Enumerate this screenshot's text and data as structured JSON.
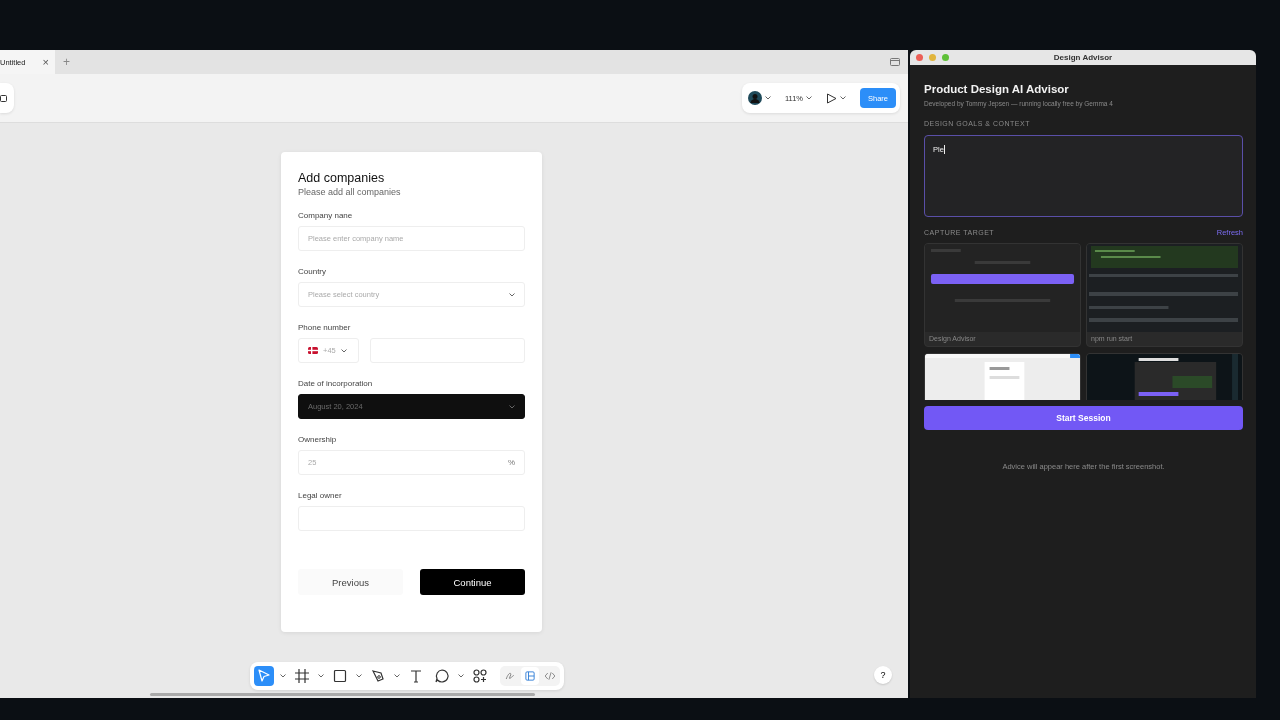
{
  "editor": {
    "tab": {
      "title": "Untitled",
      "close": "×"
    },
    "new_tab": "+",
    "zoom": "111%",
    "share": "Share",
    "help": "?",
    "tools": [
      {
        "kind": "move",
        "selected": true,
        "menu": true
      },
      {
        "kind": "frame",
        "selected": false,
        "menu": true
      },
      {
        "kind": "rect",
        "selected": false,
        "menu": true
      },
      {
        "kind": "pen",
        "selected": false,
        "menu": true
      },
      {
        "kind": "text",
        "selected": false,
        "menu": false
      },
      {
        "kind": "comment",
        "selected": false,
        "menu": true
      },
      {
        "kind": "components",
        "selected": false,
        "menu": false
      }
    ],
    "modes": [
      {
        "kind": "draw",
        "selected": false
      },
      {
        "kind": "design",
        "selected": true
      },
      {
        "kind": "dev",
        "selected": false
      }
    ]
  },
  "form": {
    "title": "Add companies",
    "subtitle": "Please add all companies",
    "fields": [
      {
        "kind": "text",
        "label": "Company nane",
        "placeholder": "Please enter company name"
      },
      {
        "kind": "select",
        "label": "Country",
        "placeholder": "Please select country"
      },
      {
        "kind": "phone",
        "label": "Phone number",
        "code": "+45"
      },
      {
        "kind": "date",
        "label": "Date of incorporation",
        "value": "August 20, 2024"
      },
      {
        "kind": "suffix",
        "label": "Ownership",
        "placeholder": "25",
        "suffix": "%"
      },
      {
        "kind": "text",
        "label": "Legal owner"
      }
    ],
    "buttons": [
      {
        "kind": "secondary",
        "label": "Previous"
      },
      {
        "kind": "primary",
        "label": "Continue"
      }
    ]
  },
  "advisor": {
    "window_title": "Design Advisor",
    "title": "Product Design AI Advisor",
    "subtitle": "Developed by Tommy Jepsen — running locally free by Gemma 4",
    "goals_label": "DESIGN GOALS & CONTEXT",
    "goals_value": "Ple",
    "capture_label": "CAPTURE TARGET",
    "refresh": "Refresh",
    "targets": [
      {
        "kind": "dark",
        "name": "Design Advisor"
      },
      {
        "kind": "terminal",
        "name": "npm run start"
      },
      {
        "kind": "light"
      },
      {
        "kind": "canvas"
      }
    ],
    "start": "Start Session",
    "empty": "Advice will appear here after the first screenshot."
  }
}
